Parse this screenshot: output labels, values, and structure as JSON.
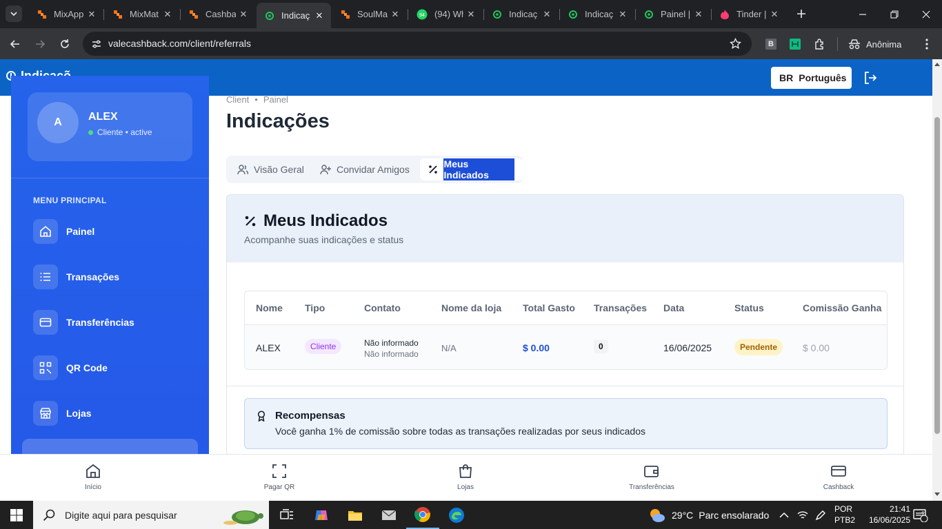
{
  "browser": {
    "tabs": [
      {
        "title": "MixApp",
        "favicon": "mixapp-icon",
        "active": false
      },
      {
        "title": "MixMat",
        "favicon": "mixapp-icon",
        "active": false
      },
      {
        "title": "Cashba",
        "favicon": "mixapp-icon",
        "active": false
      },
      {
        "title": "Indicaç",
        "favicon": "globe-green-icon",
        "active": true
      },
      {
        "title": "SoulMa",
        "favicon": "mixapp-icon",
        "active": false
      },
      {
        "title": "(94) Wh",
        "favicon": "whatsapp-icon",
        "active": false
      },
      {
        "title": "Indicaç",
        "favicon": "globe-green-icon",
        "active": false
      },
      {
        "title": "Indicaç",
        "favicon": "globe-green-icon",
        "active": false
      },
      {
        "title": "Painel |",
        "favicon": "globe-green-icon",
        "active": false
      },
      {
        "title": "Tinder |",
        "favicon": "tinder-icon",
        "active": false
      }
    ],
    "whatsapp_badge": "94",
    "url": "valecashback.com/client/referrals",
    "incognito_label": "Anônima",
    "ext_b_label": "B"
  },
  "header": {
    "partial_title": "Indicaçõ",
    "lang_code": "BR",
    "lang_label": "Português"
  },
  "sidebar": {
    "avatar_initial": "A",
    "user_name": "ALEX",
    "user_role": "Cliente • active",
    "menu_heading": "MENU PRINCIPAL",
    "items": [
      {
        "label": "Painel",
        "icon": "home-icon"
      },
      {
        "label": "Transações",
        "icon": "list-icon"
      },
      {
        "label": "Transferências",
        "icon": "card-icon"
      },
      {
        "label": "QR Code",
        "icon": "qr-code-icon"
      },
      {
        "label": "Lojas",
        "icon": "store-icon"
      }
    ]
  },
  "main": {
    "breadcrumb": [
      "Client",
      "•",
      "Painel"
    ],
    "page_title": "Indicações",
    "tabs": [
      {
        "label": "Visão Geral",
        "icon": "users-icon"
      },
      {
        "label": "Convidar Amigos",
        "icon": "user-plus-icon"
      },
      {
        "label": "Meus Indicados",
        "icon": "percent-icon",
        "selected": true
      }
    ],
    "card": {
      "title": "Meus Indicados",
      "subtitle": "Acompanhe suas indicações e status",
      "columns": [
        "Nome",
        "Tipo",
        "Contato",
        "Nome da loja",
        "Total Gasto",
        "Transações",
        "Data",
        "Status",
        "Comissão Ganha"
      ],
      "rows": [
        {
          "nome": "ALEX",
          "tipo": "Cliente",
          "contato_1": "Não informado",
          "contato_2": "Não informado",
          "loja": "N/A",
          "total_gasto": "$ 0.00",
          "transacoes": "0",
          "data": "16/06/2025",
          "status": "Pendente",
          "comissao": "$ 0.00"
        }
      ],
      "reward_title": "Recompensas",
      "reward_text": "Você ganha 1% de comissão sobre todas as transações realizadas por seus indicados"
    }
  },
  "bottom_nav": [
    {
      "label": "Início",
      "icon": "home-icon"
    },
    {
      "label": "Pagar QR",
      "icon": "scan-icon"
    },
    {
      "label": "Lojas",
      "icon": "bag-icon"
    },
    {
      "label": "Transferências",
      "icon": "wallet-icon"
    },
    {
      "label": "Cashback",
      "icon": "credit-card-icon"
    }
  ],
  "taskbar": {
    "search_placeholder": "Digite aqui para pesquisar",
    "weather_temp": "29°C",
    "weather_desc": "Parc ensolarado",
    "lang_1": "POR",
    "lang_2": "PTB2",
    "time": "21:41",
    "date": "16/06/2025",
    "notif_count": "2"
  },
  "colors": {
    "header_blue": "#0b63c6",
    "sidebar_blue": "#2563eb",
    "status_pending_bg": "#fef3c7",
    "status_pending_fg": "#a16207",
    "amount_blue": "#1d4ed8",
    "tipo_purple": "#9333ea"
  }
}
